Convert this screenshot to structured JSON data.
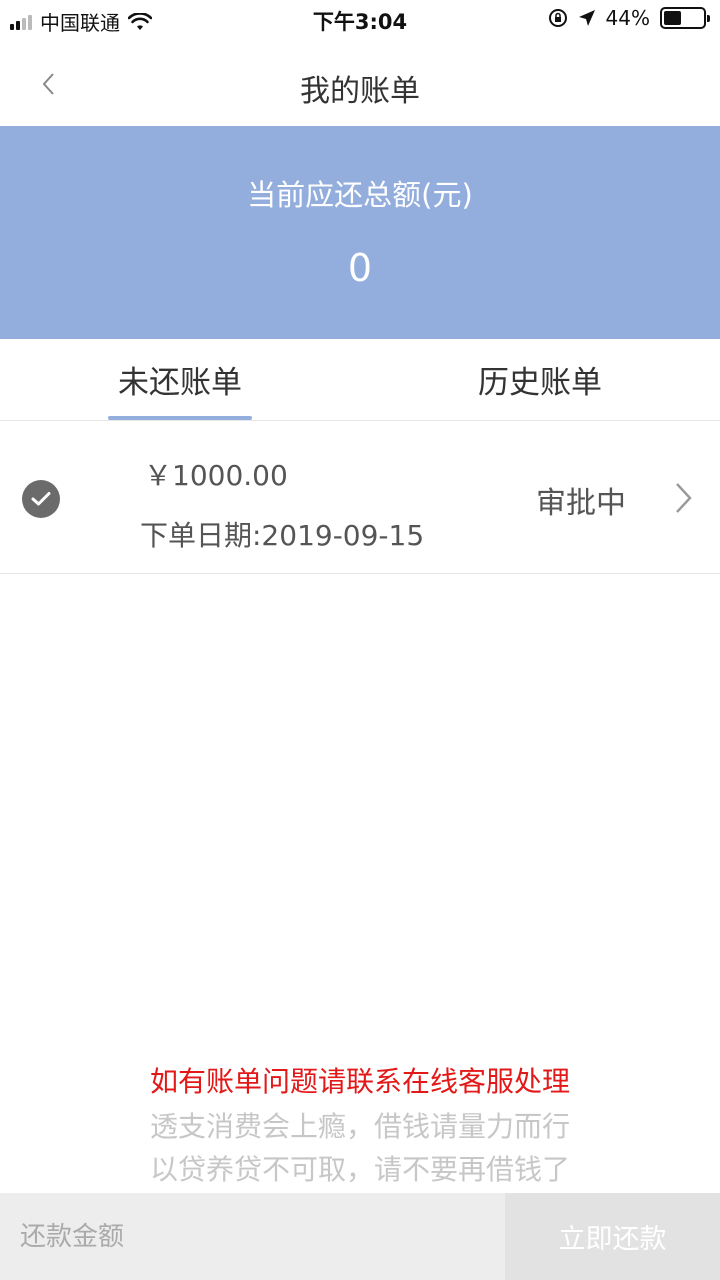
{
  "status_bar": {
    "carrier": "中国联通",
    "time": "下午3:04",
    "battery": "44%",
    "battery_level": 0.44
  },
  "nav": {
    "title": "我的账单"
  },
  "summary": {
    "label": "当前应还总额(元)",
    "amount": "0"
  },
  "tabs": {
    "unpaid": "未还账单",
    "history": "历史账单"
  },
  "bill": {
    "amount": "￥1000.00",
    "date": "下单日期:2019-09-15",
    "status": "审批中"
  },
  "notices": {
    "red": "如有账单问题请联系在线客服处理",
    "gray_1": "透支消费会上瘾，借钱请量力而行",
    "gray_2": "以贷养贷不可取，请不要再借钱了"
  },
  "bottom": {
    "input_placeholder": "还款金额",
    "pay_label": "立即还款"
  }
}
